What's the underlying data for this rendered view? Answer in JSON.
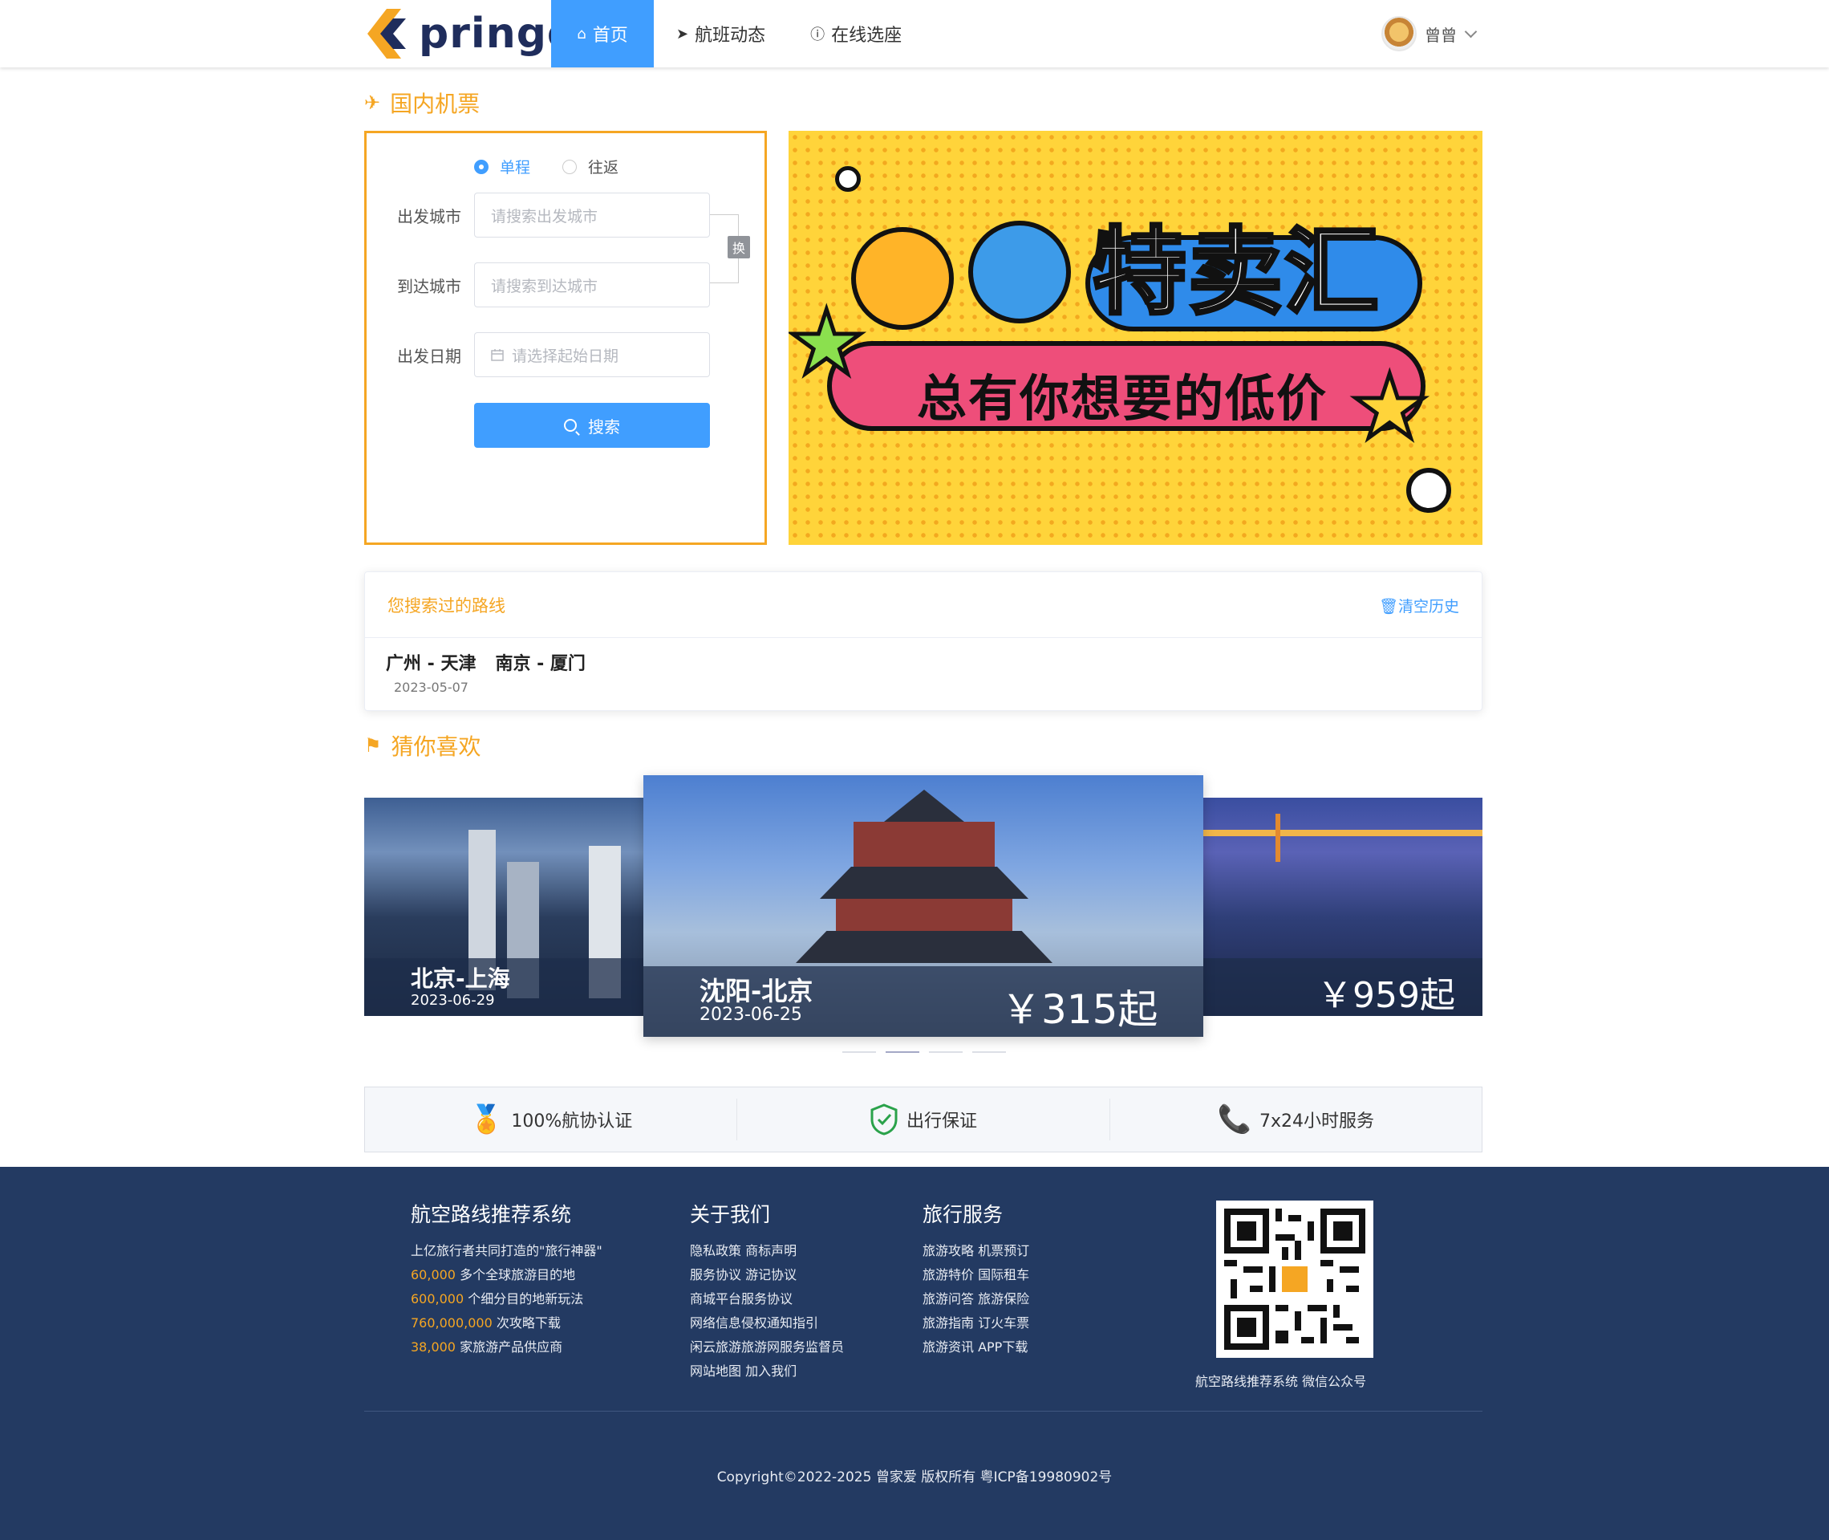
{
  "header": {
    "logo_text": "pringo",
    "nav": [
      {
        "label": "首页",
        "icon": "home-icon",
        "active": true
      },
      {
        "label": "航班动态",
        "icon": "send-icon",
        "active": false
      },
      {
        "label": "在线选座",
        "icon": "info-icon",
        "active": false
      }
    ],
    "user_name": "曾曾"
  },
  "domestic": {
    "title": "国内机票",
    "trip_types": [
      "单程",
      "往返"
    ],
    "selected_trip": "单程",
    "from_label": "出发城市",
    "from_placeholder": "请搜索出发城市",
    "to_label": "到达城市",
    "to_placeholder": "请搜索到达城市",
    "date_label": "出发日期",
    "date_placeholder": "请选择起始日期",
    "swap_label": "换",
    "search_label": "搜索"
  },
  "banner": {
    "title": "特卖汇",
    "subtitle": "总有你想要的低价"
  },
  "history": {
    "title": "您搜索过的路线",
    "clear_label": "清空历史",
    "routes": [
      "广州 - 天津",
      "南京 - 厦门"
    ],
    "date": "2023-05-07"
  },
  "recommend": {
    "title": "猜你喜欢",
    "cards": [
      {
        "city": "北京-上海",
        "date": "2023-06-29",
        "price": ""
      },
      {
        "city": "沈阳-北京",
        "date": "2023-06-25",
        "price": "￥315起"
      },
      {
        "city": "",
        "date": "",
        "price": "￥959起"
      }
    ],
    "indicator_count": 4,
    "active_indicator": 1
  },
  "features": [
    {
      "label": "100%航协认证",
      "icon": "certificate-icon"
    },
    {
      "label": "出行保证",
      "icon": "shield-check-icon"
    },
    {
      "label": "7x24小时服务",
      "icon": "phone-icon"
    }
  ],
  "footer": {
    "about": {
      "title": "航空路线推荐系统",
      "tagline": "上亿旅行者共同打造的\"旅行神器\"",
      "stats": [
        {
          "num": "60,000",
          "text": " 多个全球旅游目的地"
        },
        {
          "num": "600,000",
          "text": " 个细分目的地新玩法"
        },
        {
          "num": "760,000,000",
          "text": " 次攻略下载"
        },
        {
          "num": "38,000",
          "text": " 家旅游产品供应商"
        }
      ]
    },
    "us": {
      "title": "关于我们",
      "links": [
        "隐私政策 商标声明",
        "服务协议 游记协议",
        "商城平台服务协议",
        "网络信息侵权通知指引",
        "闲云旅游旅游网服务监督员",
        "网站地图 加入我们"
      ]
    },
    "service": {
      "title": "旅行服务",
      "links": [
        "旅游攻略 机票预订",
        "旅游特价 国际租车",
        "旅游问答 旅游保险",
        "旅游指南 订火车票",
        "旅游资讯 APP下载"
      ]
    },
    "qr_caption": "航空路线推荐系统 微信公众号",
    "copyright": "Copyright©2022-2025 曾家爱 版权所有 粤ICP备19980902号"
  }
}
